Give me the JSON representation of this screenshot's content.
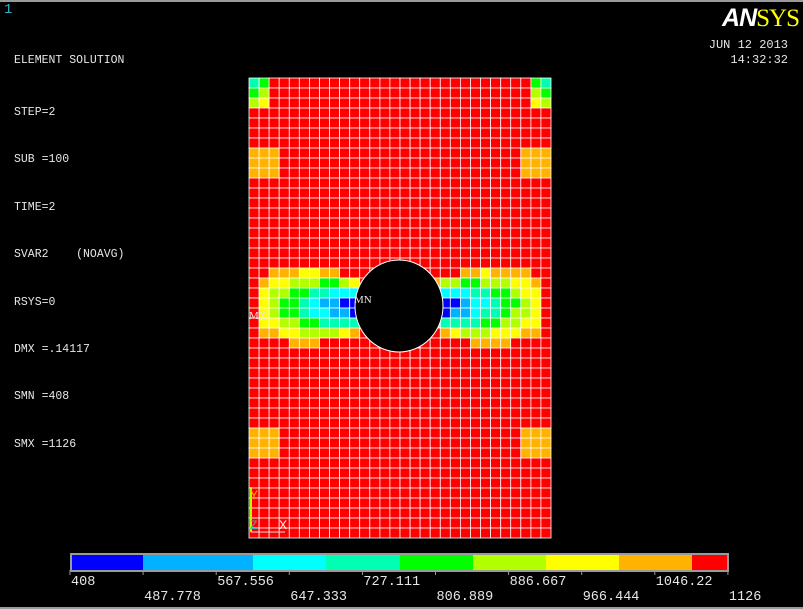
{
  "window_number": "1",
  "info": {
    "title": "ELEMENT SOLUTION",
    "lines": [
      "STEP=2",
      "SUB =100",
      "TIME=2",
      "SVAR2    (NOAVG)",
      "RSYS=0",
      "DMX =.14117",
      "SMN =408",
      "SMX =1126"
    ]
  },
  "logo": {
    "part1": "AN",
    "part2": "SYS"
  },
  "date": "JUN 12 2013",
  "time": "14:32:32",
  "markers": {
    "min": "MN",
    "max": "MX"
  },
  "triad": {
    "x": "X",
    "y": "Y",
    "z": "Z"
  },
  "chart_data": {
    "type": "heatmap",
    "description_type": "finite element contour plot",
    "quantity": "SVAR2",
    "min": 408,
    "max": 1126,
    "legend": {
      "placement": "bottom",
      "levels": [
        "408",
        "487.778",
        "567.556",
        "647.333",
        "727.111",
        "806.889",
        "886.667",
        "966.444",
        "1046.22",
        "1126"
      ],
      "colors": [
        "#0000ff",
        "#00b2ff",
        "#00ffff",
        "#00ffb2",
        "#00ff00",
        "#b2ff00",
        "#ffff00",
        "#ffb200",
        "#ff0000"
      ]
    },
    "mesh_line_color": "#ffffff"
  }
}
